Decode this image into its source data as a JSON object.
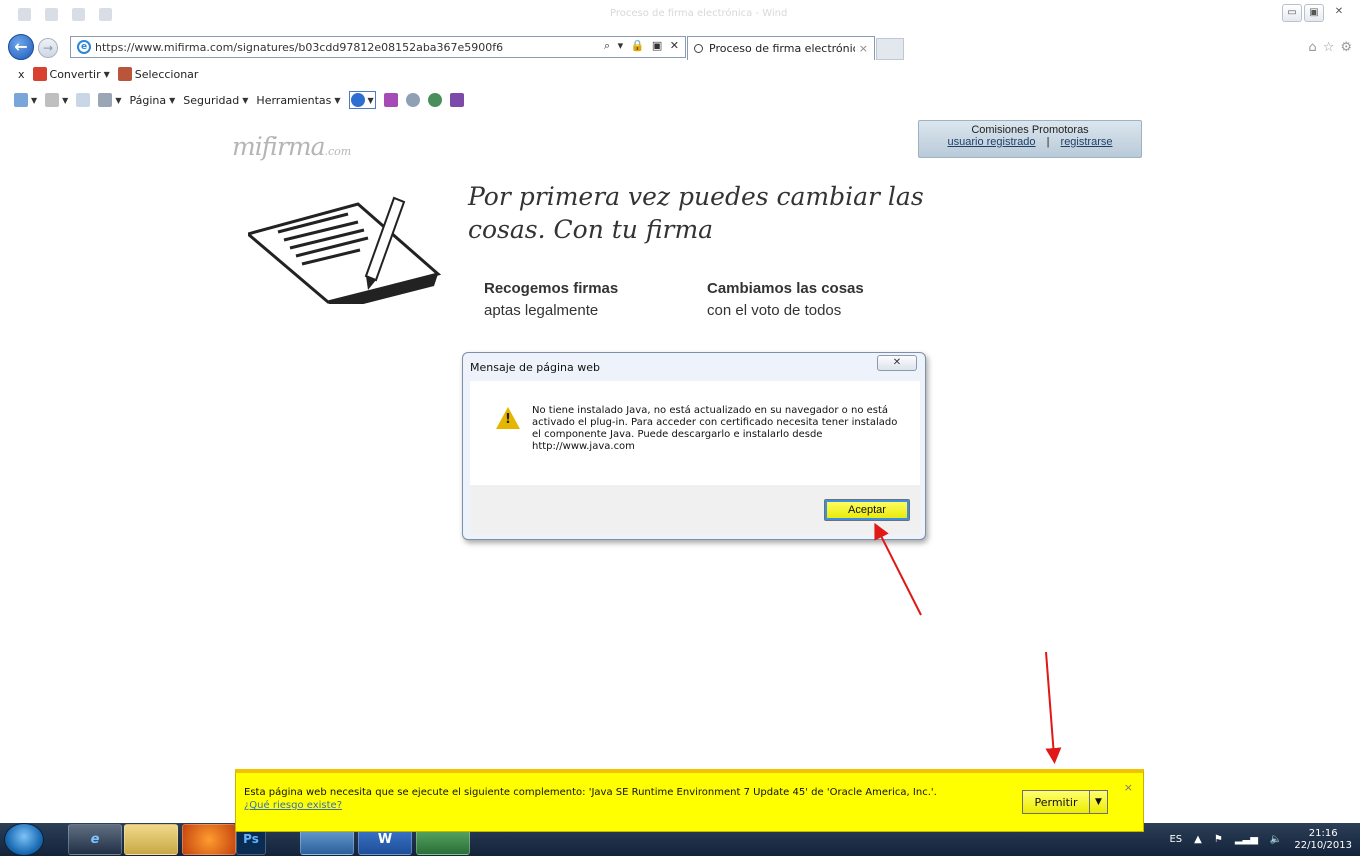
{
  "browser": {
    "window_title": "Proceso de firma electrónica - Wind",
    "address": "https://www.mifirma.com/signatures/b03cdd97812e08152aba367e5900f6",
    "address_controls": "⌕ ▾ 🔒 ▣ ✕",
    "tab_label": "Proceso de firma electrónic...",
    "tab_close": "×"
  },
  "toolbar1": {
    "close_glyph": "x",
    "convert_label": "Convertir",
    "select_label": "Seleccionar"
  },
  "toolbar2": {
    "page_label": "Página",
    "security_label": "Seguridad",
    "tools_label": "Herramientas"
  },
  "page": {
    "logo_text": "mifirma",
    "logo_suffix": ".com",
    "promo_title": "Comisiones Promotoras",
    "promo_registered": "usuario registrado",
    "promo_separator": "|",
    "promo_register": "registrarse",
    "headline": "Por primera vez puedes cambiar las cosas. Con tu firma",
    "col1_title": "Recogemos firmas",
    "col1_text": "aptas legalmente",
    "col2_title": "Cambiamos las cosas",
    "col2_text": "con el voto de todos"
  },
  "dialog": {
    "title": "Mensaje de página web",
    "close_glyph": "✕",
    "message": "No tiene instalado Java, no está actualizado en su navegador o no está activado el plug-in. Para acceder con certificado necesita tener instalado el componente Java. Puede descargarlo e instalarlo desde http://www.java.com",
    "ok_label": "Aceptar"
  },
  "notification": {
    "message": "Esta página web necesita que se ejecute el siguiente complemento: 'Java SE Runtime Environment 7 Update 45' de 'Oracle America, Inc.'.",
    "link": "¿Qué riesgo existe?",
    "allow_label": "Permitir",
    "close_glyph": "×"
  },
  "taskbar": {
    "items": [
      "e",
      "",
      "",
      "Ps",
      "",
      "W",
      ""
    ],
    "lang": "ES",
    "time": "21:16",
    "date": "22/10/2013"
  },
  "colors": {
    "notification_bg": "#ffff00",
    "dialog_ok": "#ffff3a",
    "arrow": "#e01818",
    "taskbar": "#1c2f48"
  }
}
